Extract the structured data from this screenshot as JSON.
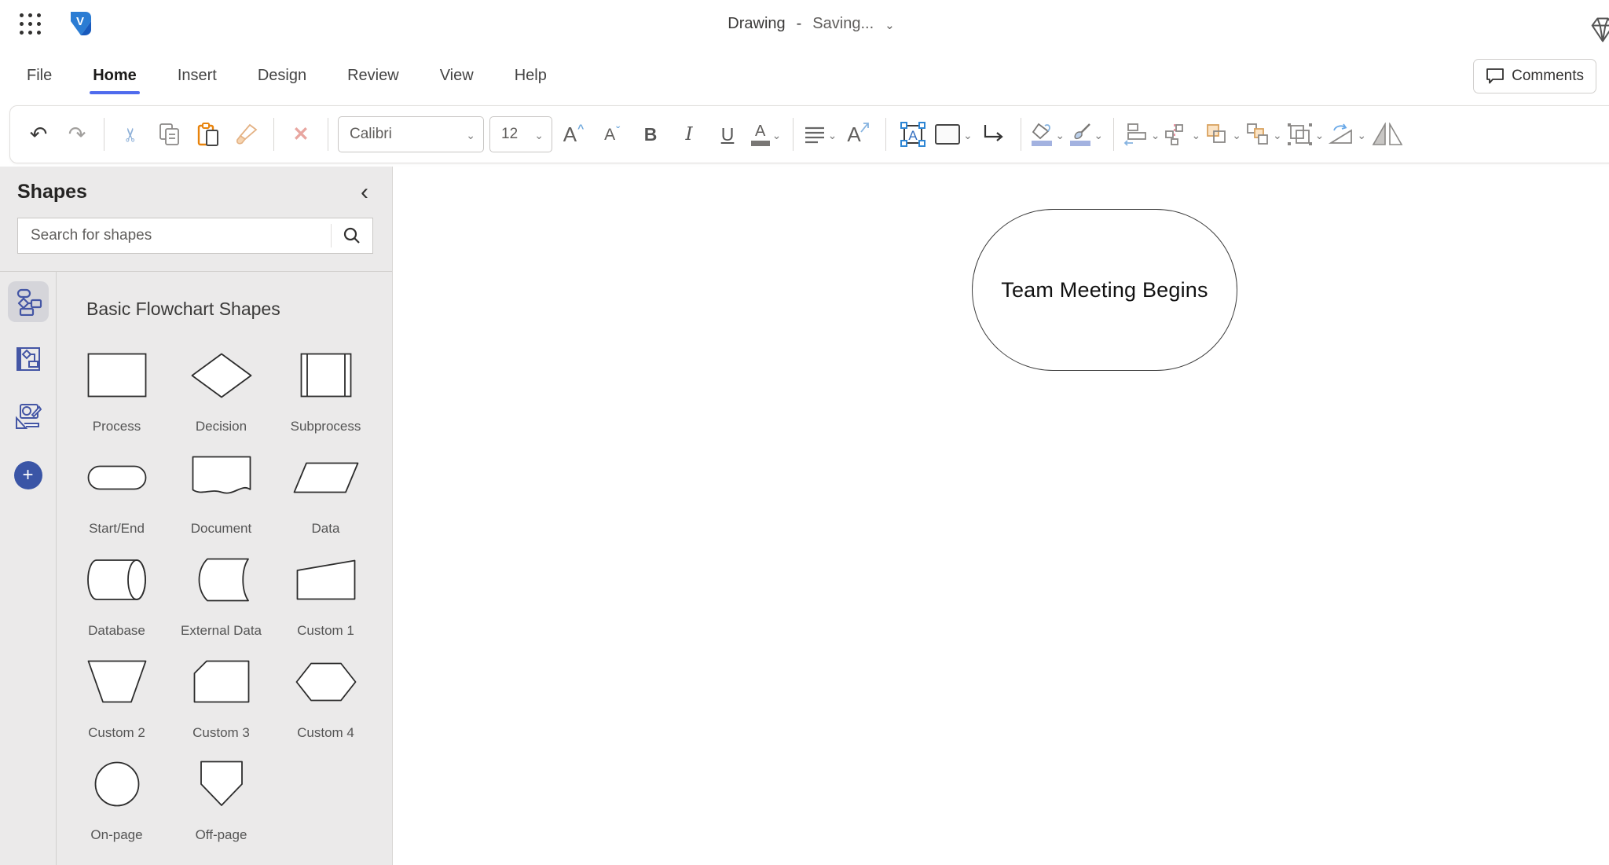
{
  "titlebar": {
    "title": "Drawing",
    "separator": "-",
    "status": "Saving...",
    "chevron": "⌄"
  },
  "menubar": {
    "items": [
      "File",
      "Home",
      "Insert",
      "Design",
      "Review",
      "View",
      "Help"
    ],
    "active_item": "Home",
    "comments_label": "Comments"
  },
  "ribbon": {
    "font_name": "Calibri",
    "font_size": "12",
    "glyphs": {
      "undo": "↶",
      "redo": "↷",
      "cut": "✂",
      "delete": "✕",
      "chevron_down": "⌄",
      "grow_letter": "A",
      "grow_mark": "^",
      "shrink_letter": "A",
      "shrink_mark": "ˇ",
      "bold": "B",
      "italic": "I",
      "underline": "U",
      "font_color_letter": "A",
      "textbox_letter": "A",
      "orientation_letter": "A"
    }
  },
  "shapes_panel": {
    "title": "Shapes",
    "collapse_glyph": "‹",
    "search_placeholder": "Search for shapes",
    "section_title": "Basic Flowchart Shapes",
    "shape_labels": [
      "Process",
      "Decision",
      "Subprocess",
      "Start/End",
      "Document",
      "Data",
      "Database",
      "External Data",
      "Custom 1",
      "Custom 2",
      "Custom 3",
      "Custom 4",
      "On-page",
      "Off-page"
    ],
    "rail_add_glyph": "+"
  },
  "canvas": {
    "shape_text": "Team Meeting Begins"
  },
  "colors": {
    "accent_blue": "#4f6bed",
    "stencil_blue": "#4456a5",
    "panel_bg": "#ebeaea",
    "paste_orange": "#e8830c",
    "fill_bar_blue": "#a3b2e0",
    "delete_red": "#e8a6a0",
    "handle_blue": "#2e86d4",
    "forward_orange": "#fbe3c4"
  }
}
